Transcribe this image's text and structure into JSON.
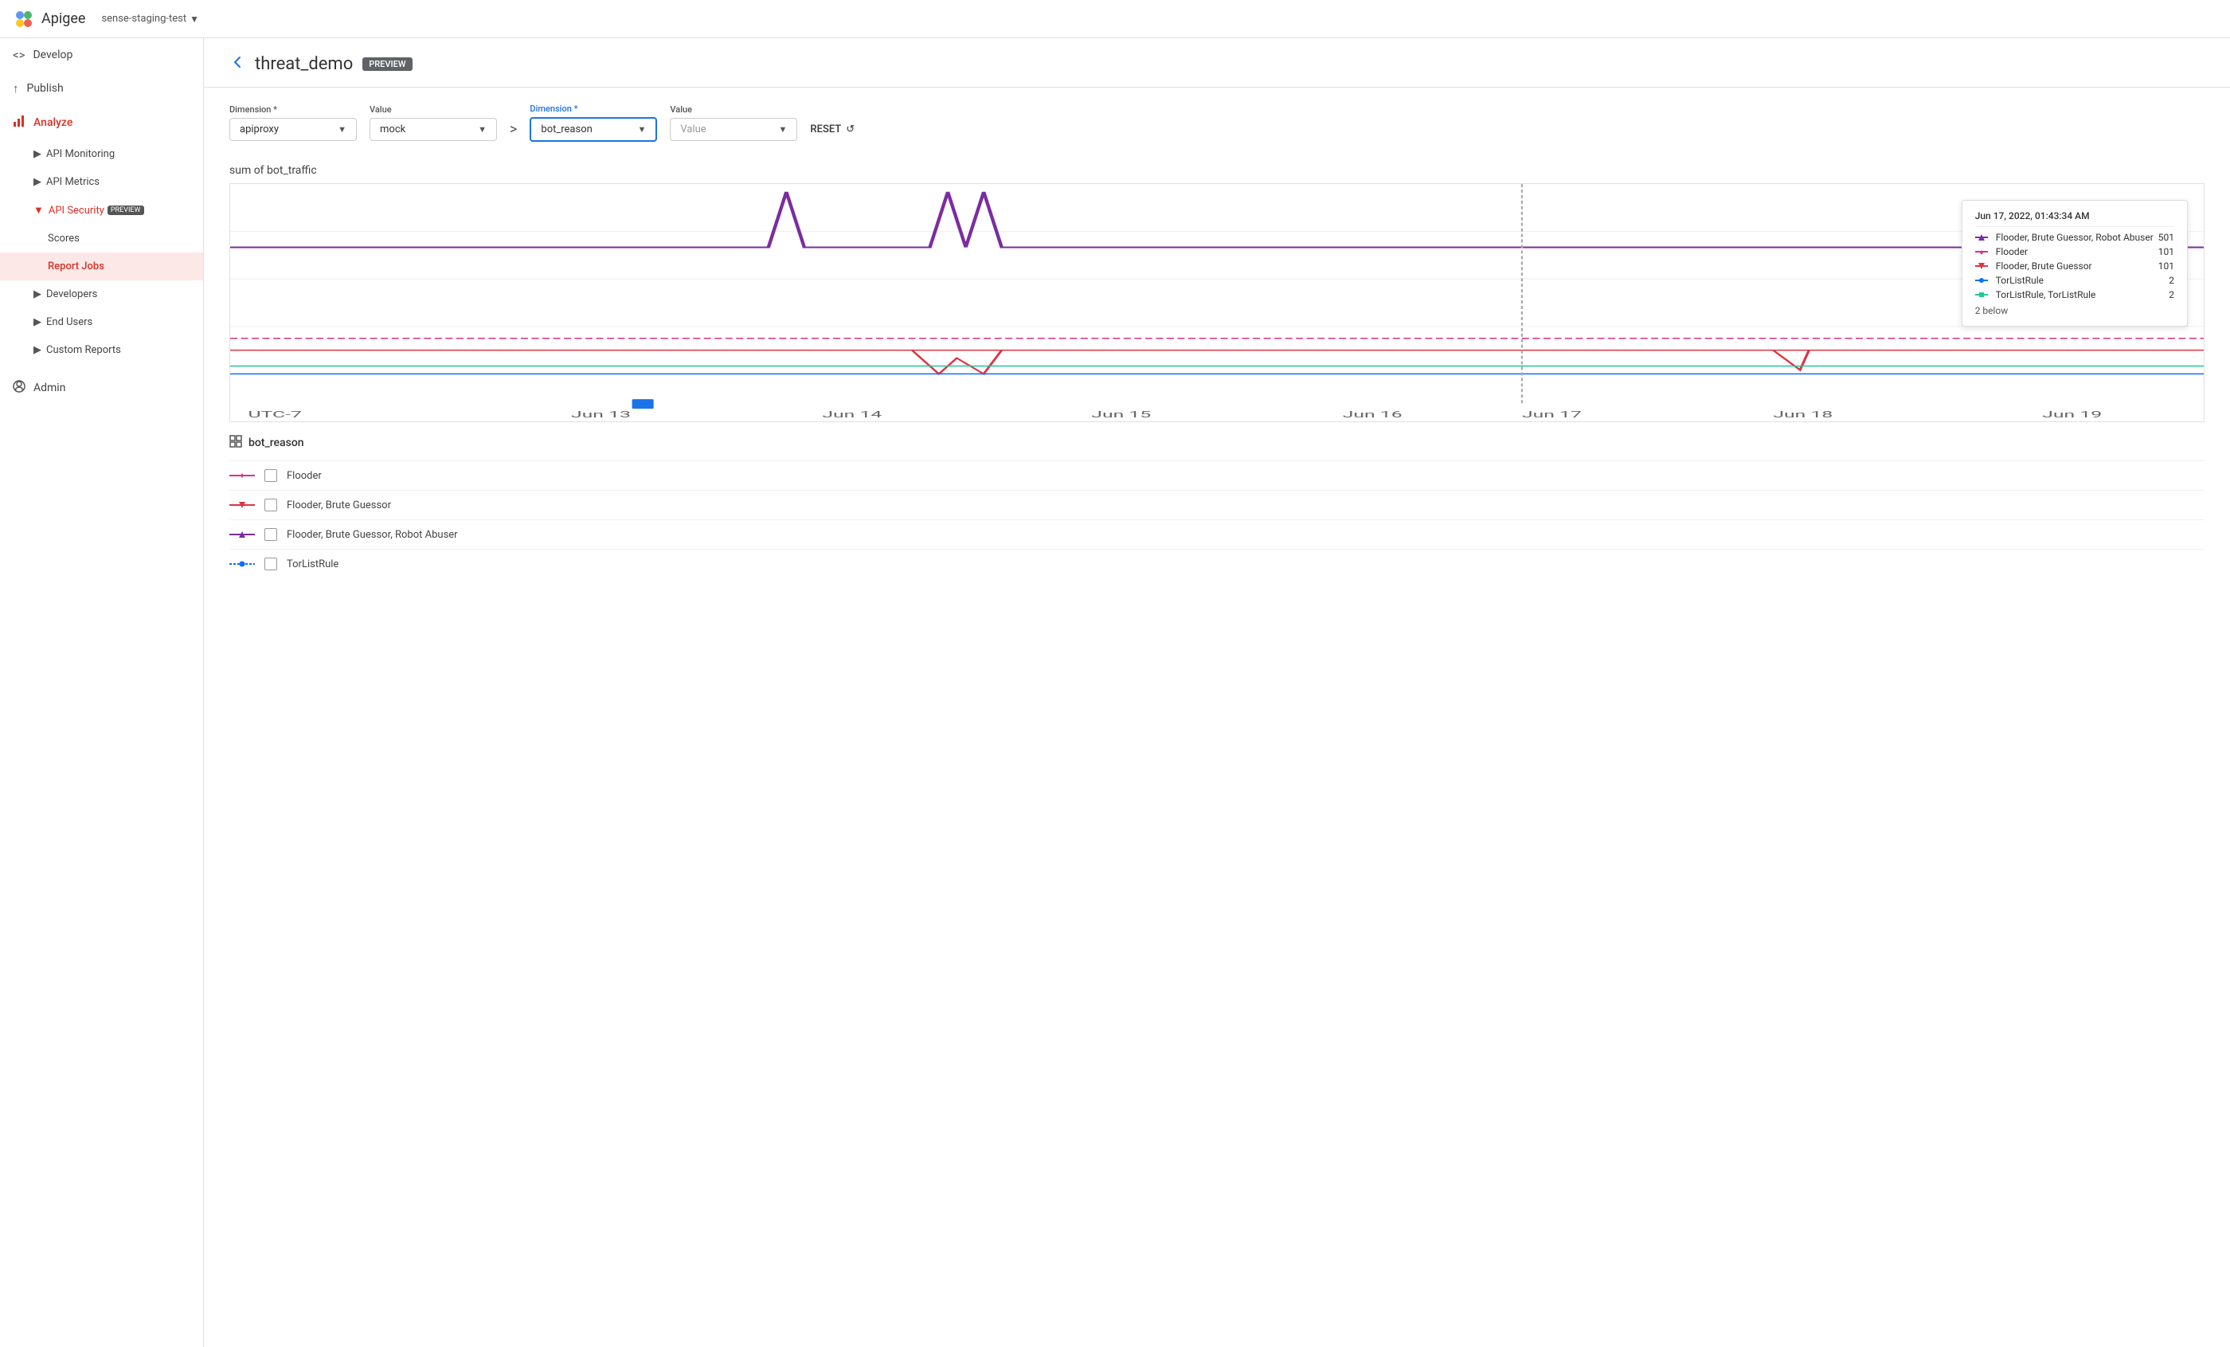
{
  "topbar": {
    "logo_alt": "Apigee logo",
    "app_name": "Apigee",
    "org_name": "sense-staging-test",
    "org_arrow": "▼"
  },
  "sidebar": {
    "items": [
      {
        "id": "develop",
        "label": "Develop",
        "icon": "code-icon",
        "expandable": true,
        "active": false
      },
      {
        "id": "publish",
        "label": "Publish",
        "icon": "publish-icon",
        "expandable": false,
        "active": false
      },
      {
        "id": "analyze",
        "label": "Analyze",
        "icon": "analyze-icon",
        "expandable": false,
        "active": true,
        "highlighted": true
      },
      {
        "id": "api-monitoring",
        "label": "API Monitoring",
        "expandable": true,
        "sub": true
      },
      {
        "id": "api-metrics",
        "label": "API Metrics",
        "expandable": true,
        "sub": true
      },
      {
        "id": "api-security",
        "label": "API Security",
        "expandable": true,
        "sub": true,
        "badge": "PREVIEW",
        "open": true
      },
      {
        "id": "scores",
        "label": "Scores",
        "sub2": true
      },
      {
        "id": "report-jobs",
        "label": "Report Jobs",
        "sub2": true,
        "active": true
      },
      {
        "id": "developers",
        "label": "Developers",
        "expandable": true,
        "sub": true
      },
      {
        "id": "end-users",
        "label": "End Users",
        "expandable": true,
        "sub": true
      },
      {
        "id": "custom-reports",
        "label": "Custom Reports",
        "expandable": true,
        "sub": true
      }
    ],
    "admin": {
      "label": "Admin",
      "icon": "admin-icon"
    }
  },
  "page": {
    "back_label": "←",
    "title": "threat_demo",
    "preview_badge": "PREVIEW"
  },
  "filters": {
    "dimension1_label": "Dimension *",
    "dimension1_value": "apiproxy",
    "value1_label": "Value",
    "value1_value": "mock",
    "arrow": ">",
    "dimension2_label": "Dimension *",
    "dimension2_value": "bot_reason",
    "value2_label": "Value",
    "value2_placeholder": "Value",
    "reset_label": "RESET"
  },
  "chart": {
    "title": "sum of bot_traffic",
    "x_labels": [
      "UTC-7",
      "Jun 13",
      "Jun 14",
      "Jun 15",
      "Jun 16",
      "Jun 17",
      "Jun 18",
      "Jun 19"
    ],
    "tooltip": {
      "date": "Jun 17, 2022, 01:43:34 AM",
      "rows": [
        {
          "label": "Flooder, Brute Guessor, Robot Abuser",
          "value": "501",
          "color": "#7b2da0",
          "type": "triangle-up"
        },
        {
          "label": "Flooder",
          "value": "101",
          "color": "#d63384",
          "type": "diamond"
        },
        {
          "label": "Flooder, Brute Guessor",
          "value": "101",
          "color": "#dc3545",
          "type": "triangle-down"
        },
        {
          "label": "TorListRule",
          "value": "2",
          "color": "#0d6efd",
          "type": "circle"
        },
        {
          "label": "TorListRule, TorListRule",
          "value": "2",
          "color": "#0dcaf0",
          "type": "square"
        }
      ],
      "below": "2 below"
    }
  },
  "legend": {
    "title": "bot_reason",
    "icon": "grid-icon",
    "items": [
      {
        "label": "Flooder",
        "color": "#d63384",
        "type": "diamond"
      },
      {
        "label": "Flooder, Brute Guessor",
        "color": "#dc3545",
        "type": "triangle-down"
      },
      {
        "label": "Flooder, Brute Guessor, Robot Abuser",
        "color": "#7b2da0",
        "type": "triangle-up"
      },
      {
        "label": "TorListRule",
        "color": "#0d6efd",
        "type": "dash-circle"
      }
    ]
  }
}
